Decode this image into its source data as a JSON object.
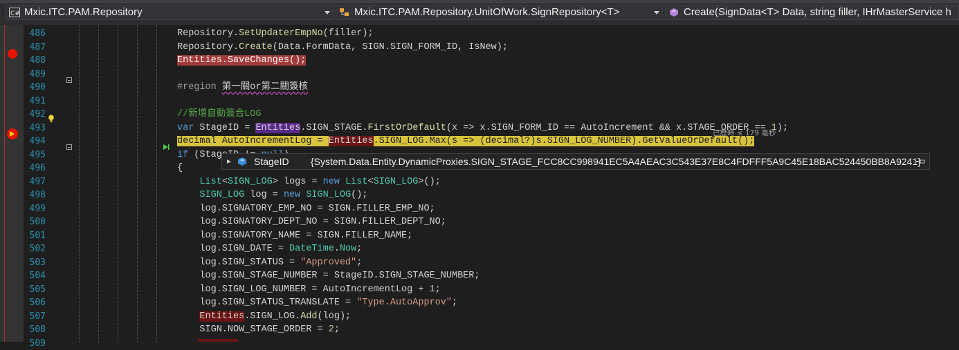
{
  "navbar": {
    "project": "Mxic.ITC.PAM.Repository",
    "project_icon": "csharp-project-icon",
    "class": "Mxic.ITC.PAM.Repository.UnitOfWork.SignRepository<T>",
    "member": "Create(SignData<T> Data, string filler, IHrMasterService h"
  },
  "tooltip": {
    "name": "StageID",
    "value": "{System.Data.Entity.DynamicProxies.SIGN_STAGE_FCC8CC998941EC5A4AEAC3C543E37E8C4FDFFF5A9C45E18BAC524450BB8A9241}"
  },
  "perf_tip": "已歷時 ≤ 179 毫秒",
  "lines": [
    {
      "n": "486",
      "t": [
        [
          "",
          "Repository."
        ],
        [
          "mth",
          "SetUpdaterEmpNo"
        ],
        [
          "",
          "(filler);"
        ]
      ]
    },
    {
      "n": "487",
      "t": [
        [
          "",
          "Repository."
        ],
        [
          "mth",
          "Create"
        ],
        [
          "",
          "(Data.FormData, SIGN.SIGN_FORM_ID, IsNew);"
        ]
      ]
    },
    {
      "n": "488",
      "t": [
        [
          "bp-hl",
          "Entities.SaveChanges();"
        ]
      ]
    },
    {
      "n": "489",
      "t": []
    },
    {
      "n": "490",
      "t": [
        [
          "pp",
          "#region "
        ],
        [
          "squig",
          "第一關or第二關簽核"
        ]
      ]
    },
    {
      "n": "491",
      "t": []
    },
    {
      "n": "492",
      "t": [
        [
          "cm",
          "//新增自動簽合LOG"
        ]
      ]
    },
    {
      "n": "493",
      "t": [
        [
          "kw",
          "var"
        ],
        [
          "",
          " StageID = "
        ],
        [
          "ref-hl",
          "Entities"
        ],
        [
          "",
          ".SIGN_STAGE."
        ],
        [
          "mth",
          "FirstOrDefault"
        ],
        [
          "",
          "(x => x.SIGN_FORM_ID == AutoIncrement && x.STAGE_ORDER == "
        ],
        [
          "num",
          "1"
        ],
        [
          "",
          ");"
        ]
      ]
    },
    {
      "n": "494",
      "t": [
        [
          "cur-hl",
          "decimal AutoIncrementLog = "
        ],
        [
          "ref-dark",
          "Entities"
        ],
        [
          "cur-hl",
          ".SIGN_LOG.Max(s => (decimal?)s.SIGN_LOG_NUMBER).GetValueOrDefault();"
        ]
      ]
    },
    {
      "n": "495",
      "t": [
        [
          "kw",
          "if"
        ],
        [
          "",
          " (StageID != "
        ],
        [
          "kw",
          "null"
        ],
        [
          "",
          ")"
        ]
      ]
    },
    {
      "n": "496",
      "t": [
        [
          "",
          "{"
        ]
      ]
    },
    {
      "n": "497",
      "t": [
        [
          "",
          "    "
        ],
        [
          "ty",
          "List"
        ],
        [
          "",
          "<"
        ],
        [
          "ty",
          "SIGN_LOG"
        ],
        [
          "",
          "> logs = "
        ],
        [
          "kw",
          "new"
        ],
        [
          "",
          " "
        ],
        [
          "ty",
          "List"
        ],
        [
          "",
          "<"
        ],
        [
          "ty",
          "SIGN_LOG"
        ],
        [
          "",
          ">();"
        ]
      ]
    },
    {
      "n": "498",
      "t": [
        [
          "",
          "    "
        ],
        [
          "ty",
          "SIGN_LOG"
        ],
        [
          "",
          " log = "
        ],
        [
          "kw",
          "new"
        ],
        [
          "",
          " "
        ],
        [
          "ty",
          "SIGN_LOG"
        ],
        [
          "",
          "();"
        ]
      ]
    },
    {
      "n": "499",
      "t": [
        [
          "",
          "    log.SIGNATORY_EMP_NO = SIGN.FILLER_EMP_NO;"
        ]
      ]
    },
    {
      "n": "500",
      "t": [
        [
          "",
          "    log.SIGNATORY_DEPT_NO = SIGN.FILLER_DEPT_NO;"
        ]
      ]
    },
    {
      "n": "501",
      "t": [
        [
          "",
          "    log.SIGNATORY_NAME = SIGN.FILLER_NAME;"
        ]
      ]
    },
    {
      "n": "502",
      "t": [
        [
          "",
          "    log.SIGN_DATE = "
        ],
        [
          "ty",
          "DateTime"
        ],
        [
          "",
          "."
        ],
        [
          "ty",
          "Now"
        ],
        [
          "",
          ";"
        ]
      ]
    },
    {
      "n": "503",
      "t": [
        [
          "",
          "    log.SIGN_STATUS = "
        ],
        [
          "str",
          "\"Approved\""
        ],
        [
          "",
          ";"
        ]
      ]
    },
    {
      "n": "504",
      "t": [
        [
          "",
          "    log.SIGN_STAGE_NUMBER = StageID.SIGN_STAGE_NUMBER;"
        ]
      ]
    },
    {
      "n": "505",
      "t": [
        [
          "",
          "    log.SIGN_LOG_NUMBER = AutoIncrementLog + "
        ],
        [
          "num",
          "1"
        ],
        [
          "",
          ";"
        ]
      ]
    },
    {
      "n": "506",
      "t": [
        [
          "",
          "    log.SIGN_STATUS_TRANSLATE = "
        ],
        [
          "str",
          "\"Type.AutoApprov\""
        ],
        [
          "",
          ";"
        ]
      ]
    },
    {
      "n": "507",
      "t": [
        [
          "",
          "    "
        ],
        [
          "ref-dark",
          "Entities"
        ],
        [
          "",
          ".SIGN_LOG."
        ],
        [
          "mth",
          "Add"
        ],
        [
          "",
          "(log);"
        ]
      ]
    },
    {
      "n": "508",
      "t": [
        [
          "",
          "    SIGN.NOW_STAGE_ORDER = "
        ],
        [
          "num",
          "2"
        ],
        [
          "",
          ";"
        ]
      ]
    },
    {
      "n": "509",
      "t": []
    }
  ]
}
